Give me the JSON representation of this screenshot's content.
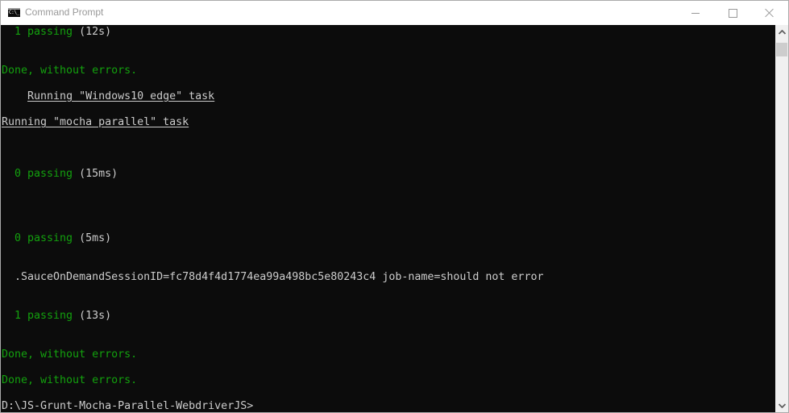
{
  "window": {
    "title": "Command Prompt",
    "icon": "cmd-icon",
    "icon_text": "C:\\_",
    "controls": {
      "minimize": "minimize-icon",
      "maximize": "maximize-icon",
      "close": "close-icon"
    }
  },
  "colors": {
    "background": "#0c0c0c",
    "text": "#cccccc",
    "green": "#13a10e",
    "titlebar": "#ffffff",
    "scrollbar_track": "#f0f0f0",
    "scrollbar_thumb": "#cdcdcd"
  },
  "console": {
    "lines": [
      {
        "row": 0,
        "segments": [
          {
            "text": "  1 passing",
            "style": "green"
          },
          {
            "text": " (12s)",
            "style": "grey"
          }
        ]
      },
      {
        "row": 3,
        "segments": [
          {
            "text": "Done, without errors.",
            "style": "green"
          }
        ]
      },
      {
        "row": 5,
        "segments": [
          {
            "text": "    ",
            "style": "grey"
          },
          {
            "text": "Running \"Windows10 edge\" task",
            "style": "grey-underline"
          }
        ]
      },
      {
        "row": 7,
        "segments": [
          {
            "text": "Running \"mocha parallel\" task",
            "style": "grey-underline"
          }
        ]
      },
      {
        "row": 11,
        "segments": [
          {
            "text": "  0 passing",
            "style": "green"
          },
          {
            "text": " (15ms)",
            "style": "grey"
          }
        ]
      },
      {
        "row": 16,
        "segments": [
          {
            "text": "  0 passing",
            "style": "green"
          },
          {
            "text": " (5ms)",
            "style": "grey"
          }
        ]
      },
      {
        "row": 19,
        "segments": [
          {
            "text": "  .SauceOnDemandSessionID=fc78d4f4d1774ea99a498bc5e80243c4 job-name=should not error",
            "style": "grey"
          }
        ]
      },
      {
        "row": 22,
        "segments": [
          {
            "text": "  1 passing",
            "style": "green"
          },
          {
            "text": " (13s)",
            "style": "grey"
          }
        ]
      },
      {
        "row": 25,
        "segments": [
          {
            "text": "Done, without errors.",
            "style": "green"
          }
        ]
      },
      {
        "row": 27,
        "segments": [
          {
            "text": "Done, without errors.",
            "style": "green"
          }
        ]
      },
      {
        "row": 29,
        "segments": [
          {
            "text": "D:\\JS-Grunt-Mocha-Parallel-WebdriverJS>",
            "style": "grey"
          }
        ]
      }
    ]
  },
  "scrollbar": {
    "up_arrow": "^",
    "down_arrow": "v",
    "position_fraction": 0.0
  }
}
